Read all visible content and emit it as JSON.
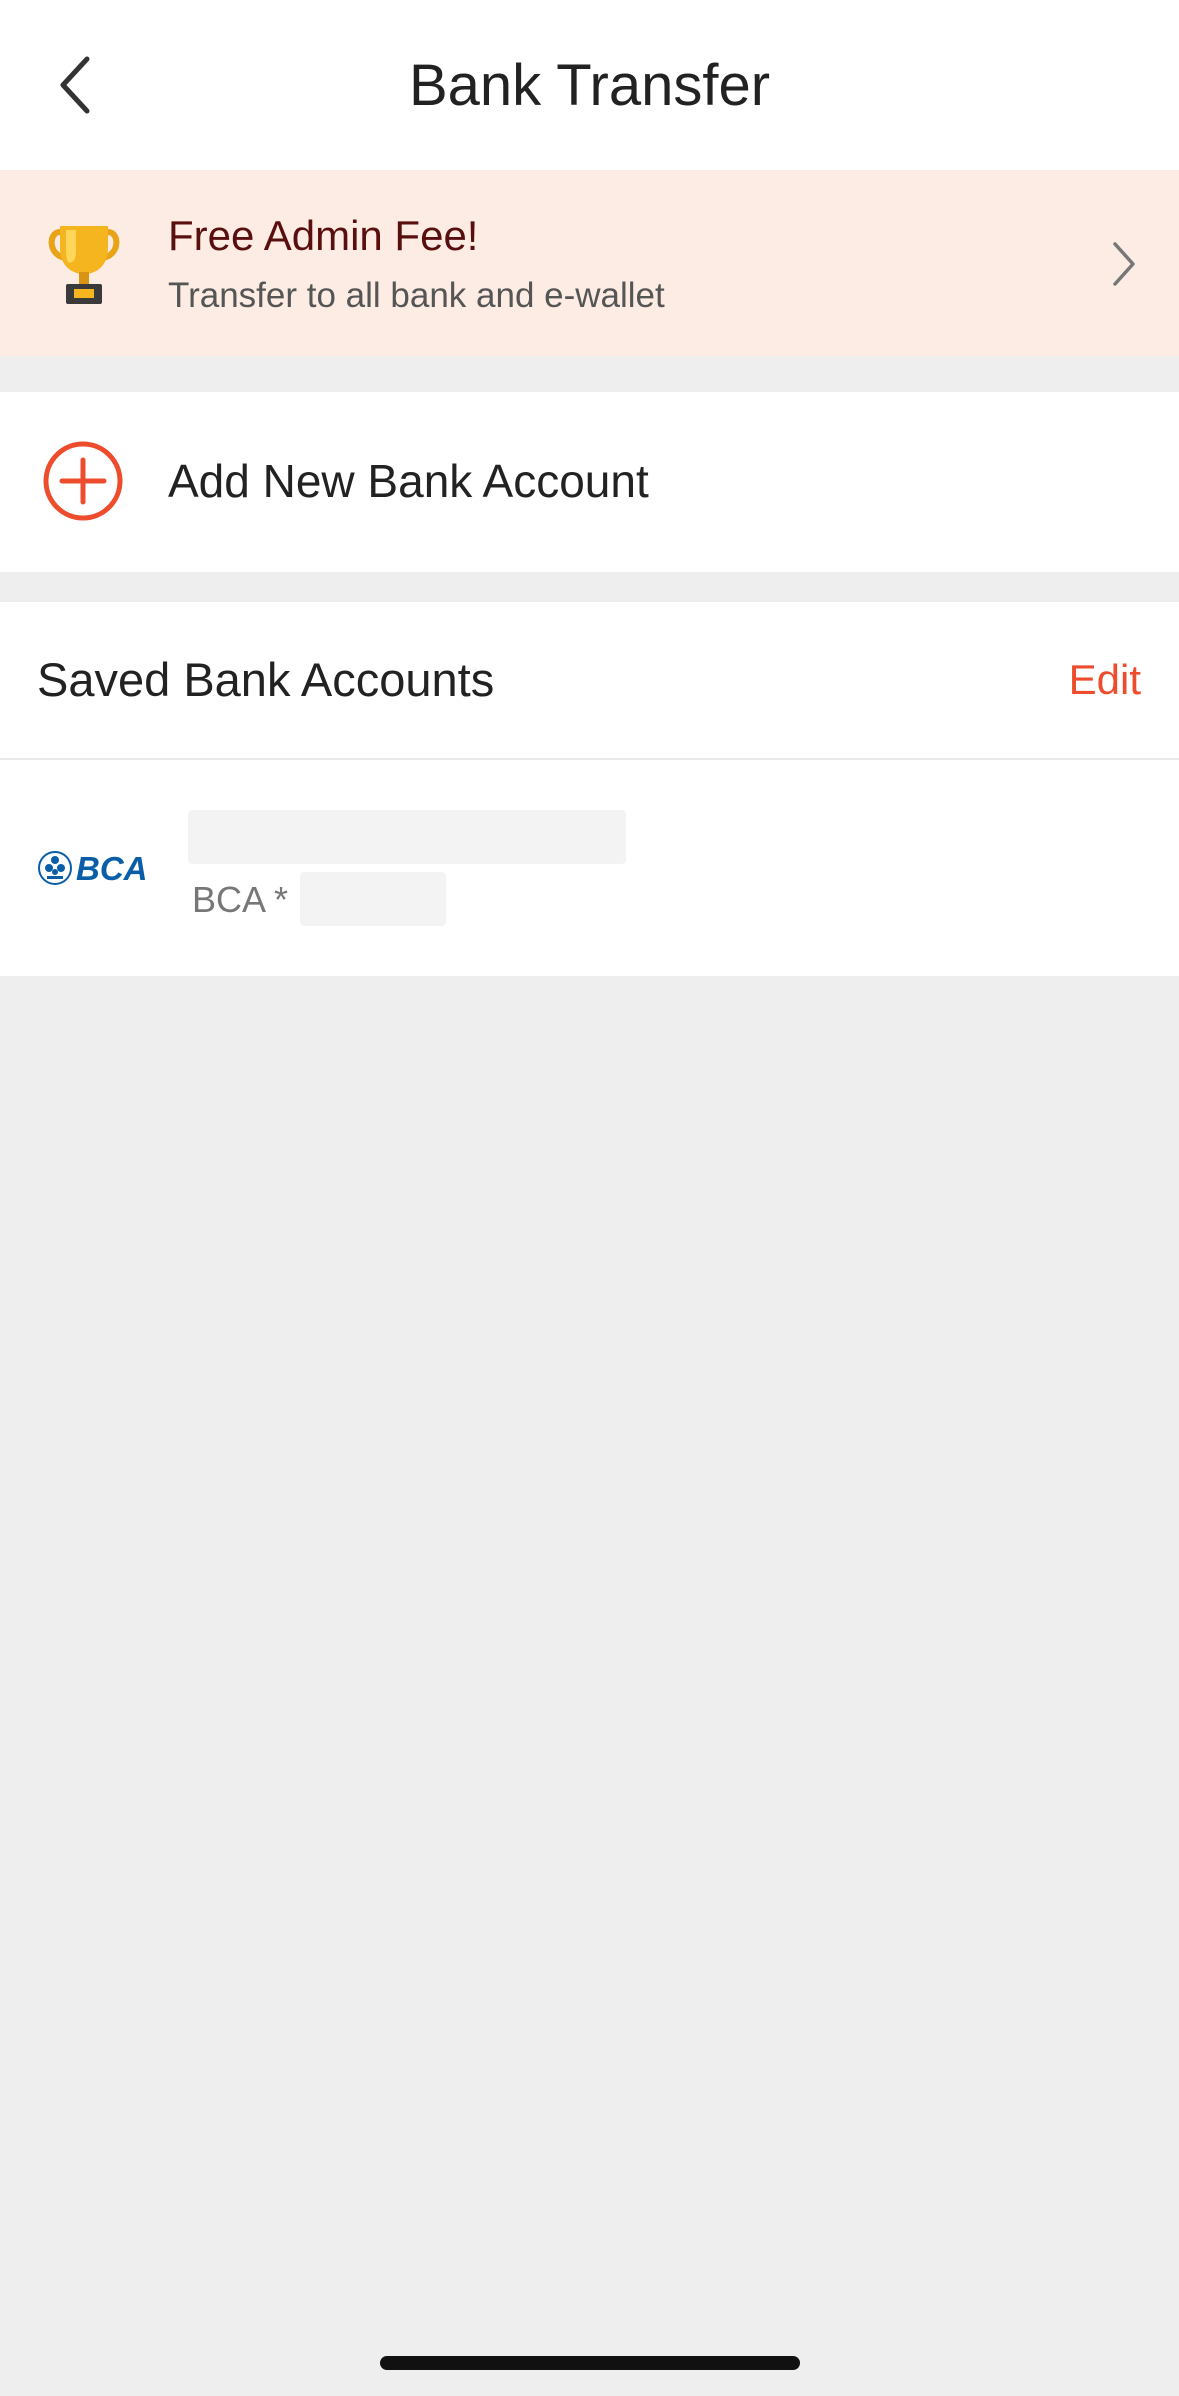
{
  "header": {
    "title": "Bank Transfer",
    "back_icon": "chevron-left-icon"
  },
  "promo": {
    "icon": "trophy-icon",
    "title": "Free Admin Fee!",
    "subtitle": "Transfer to all bank and e-wallet",
    "chevron_icon": "chevron-right-icon"
  },
  "add_account": {
    "icon": "plus-circle-icon",
    "label": "Add New Bank Account"
  },
  "saved_accounts": {
    "title": "Saved Bank Accounts",
    "edit_label": "Edit",
    "accounts": [
      {
        "bank_logo_text": "BCA",
        "subtitle": "BCA *"
      }
    ]
  },
  "colors": {
    "accent": "#ee4d2d",
    "promo_bg": "#fdece3",
    "promo_title": "#5a0f0f",
    "page_bg": "#eeeeee",
    "bca_blue": "#0a5ea8"
  }
}
